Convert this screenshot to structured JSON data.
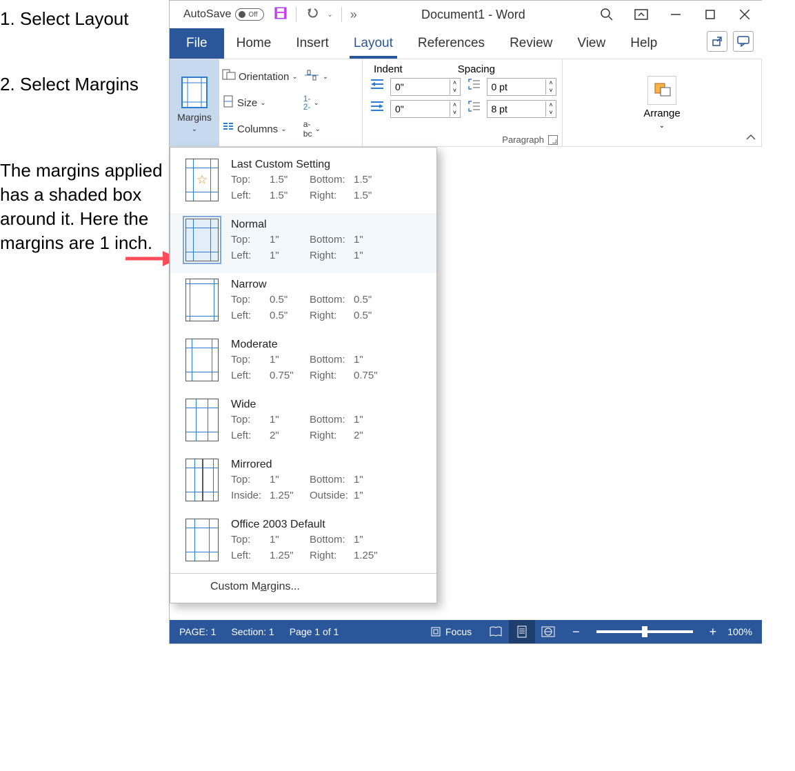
{
  "annotations": {
    "step1": "1. Select Layout",
    "step2": "2. Select Margins",
    "paragraph": "The margins applied has a shaded box around it. Here the margins are 1 inch."
  },
  "titlebar": {
    "autosave_label": "AutoSave",
    "autosave_state": "Off",
    "document_title": "Document1  -  Word",
    "more_commands": "»"
  },
  "tabs": {
    "file": "File",
    "home": "Home",
    "insert": "Insert",
    "layout": "Layout",
    "references": "References",
    "review": "Review",
    "view": "View",
    "help": "Help"
  },
  "ribbon": {
    "margins": "Margins",
    "orientation": "Orientation",
    "size": "Size",
    "columns": "Columns",
    "indent": "Indent",
    "spacing": "Spacing",
    "indent_left": "0\"",
    "indent_right": "0\"",
    "spacing_before": "0 pt",
    "spacing_after": "8 pt",
    "paragraph_label": "Paragraph",
    "arrange": "Arrange"
  },
  "margin_menu": {
    "items": [
      {
        "name": "Last Custom Setting",
        "l1": "Top:",
        "v1": "1.5\"",
        "l2": "Bottom:",
        "v2": "1.5\"",
        "l3": "Left:",
        "v3": "1.5\"",
        "l4": "Right:",
        "v4": "1.5\""
      },
      {
        "name": "Normal",
        "l1": "Top:",
        "v1": "1\"",
        "l2": "Bottom:",
        "v2": "1\"",
        "l3": "Left:",
        "v3": "1\"",
        "l4": "Right:",
        "v4": "1\""
      },
      {
        "name": "Narrow",
        "l1": "Top:",
        "v1": "0.5\"",
        "l2": "Bottom:",
        "v2": "0.5\"",
        "l3": "Left:",
        "v3": "0.5\"",
        "l4": "Right:",
        "v4": "0.5\""
      },
      {
        "name": "Moderate",
        "l1": "Top:",
        "v1": "1\"",
        "l2": "Bottom:",
        "v2": "1\"",
        "l3": "Left:",
        "v3": "0.75\"",
        "l4": "Right:",
        "v4": "0.75\""
      },
      {
        "name": "Wide",
        "l1": "Top:",
        "v1": "1\"",
        "l2": "Bottom:",
        "v2": "1\"",
        "l3": "Left:",
        "v3": "2\"",
        "l4": "Right:",
        "v4": "2\""
      },
      {
        "name": "Mirrored",
        "l1": "Top:",
        "v1": "1\"",
        "l2": "Bottom:",
        "v2": "1\"",
        "l3": "Inside:",
        "v3": "1.25\"",
        "l4": "Outside:",
        "v4": "1\""
      },
      {
        "name": "Office 2003 Default",
        "l1": "Top:",
        "v1": "1\"",
        "l2": "Bottom:",
        "v2": "1\"",
        "l3": "Left:",
        "v3": "1.25\"",
        "l4": "Right:",
        "v4": "1.25\""
      }
    ],
    "custom": "Custom Margins..."
  },
  "statusbar": {
    "page": "PAGE: 1",
    "section": "Section: 1",
    "pages": "Page 1 of 1",
    "focus": "Focus",
    "zoom": "100%"
  }
}
